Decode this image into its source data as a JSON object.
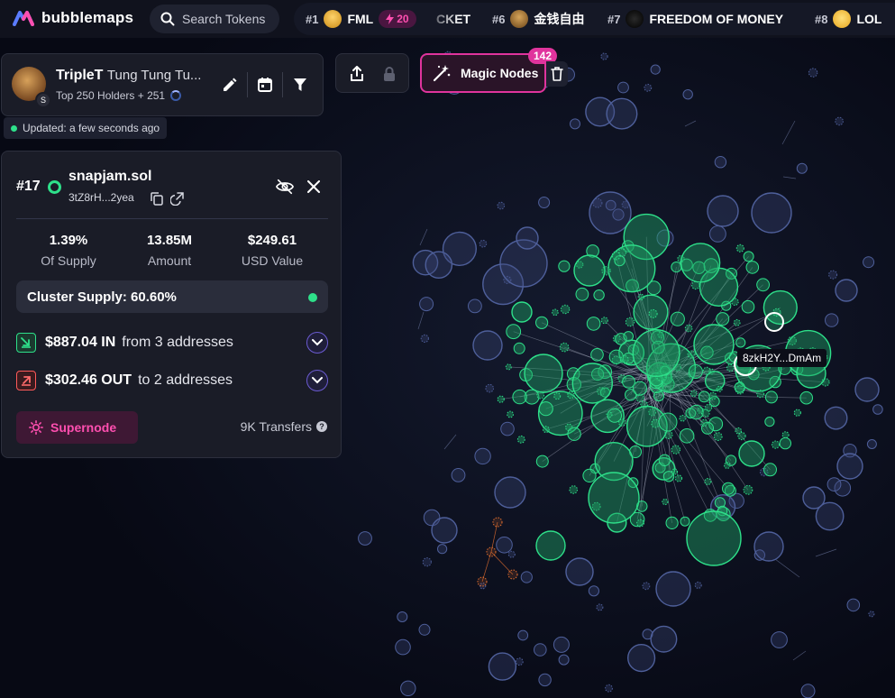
{
  "app": {
    "name": "bubblemaps"
  },
  "search": {
    "placeholder": "Search Tokens"
  },
  "ticker": [
    {
      "rank": "#1",
      "symbol": "FML",
      "boost": "20"
    },
    {
      "rank": "",
      "symbol": "CKET"
    },
    {
      "rank": "#6",
      "symbol": "金钱自由"
    },
    {
      "rank": "#7",
      "symbol": "FREEDOM OF MONEY"
    },
    {
      "rank": "#8",
      "symbol": "LOL"
    }
  ],
  "token": {
    "symbol": "TripleT",
    "name": "Tung Tung Tu...",
    "holders_label": "Top 250 Holders + 251",
    "chain_badge": "S"
  },
  "updated": "Updated: a few seconds ago",
  "magic_nodes": {
    "label": "Magic Nodes",
    "count": "142"
  },
  "holder": {
    "rank": "#17",
    "name": "snapjam.sol",
    "address": "3tZ8rH...2yea",
    "stats": [
      {
        "value": "1.39%",
        "label": "Of Supply"
      },
      {
        "value": "13.85M",
        "label": "Amount"
      },
      {
        "value": "$249.61",
        "label": "USD Value"
      }
    ],
    "cluster_supply": "Cluster Supply: 60.60%",
    "flow_in": {
      "amount": "$887.04 IN",
      "desc": "from 3 addresses"
    },
    "flow_out": {
      "amount": "$302.46 OUT",
      "desc": "to 2 addresses"
    },
    "supernode_label": "Supernode",
    "transfers": "9K Transfers"
  },
  "graph": {
    "hover_label": "8zkH2Y...DmAm"
  },
  "colors": {
    "background": "#080a16",
    "accent_pink": "#e0349d",
    "green": "#2ee08a",
    "blue_node": "#5468a6",
    "orange_node": "#e8712f"
  },
  "icons": [
    "search-icon",
    "pencil-icon",
    "calendar-icon",
    "filter-icon",
    "share-icon",
    "lock-icon",
    "magic-wand-icon",
    "trash-icon",
    "copy-icon",
    "external-link-icon",
    "eye-off-icon",
    "close-icon",
    "arrow-in-icon",
    "arrow-out-icon",
    "chevron-down-icon",
    "sun-icon",
    "question-icon"
  ]
}
